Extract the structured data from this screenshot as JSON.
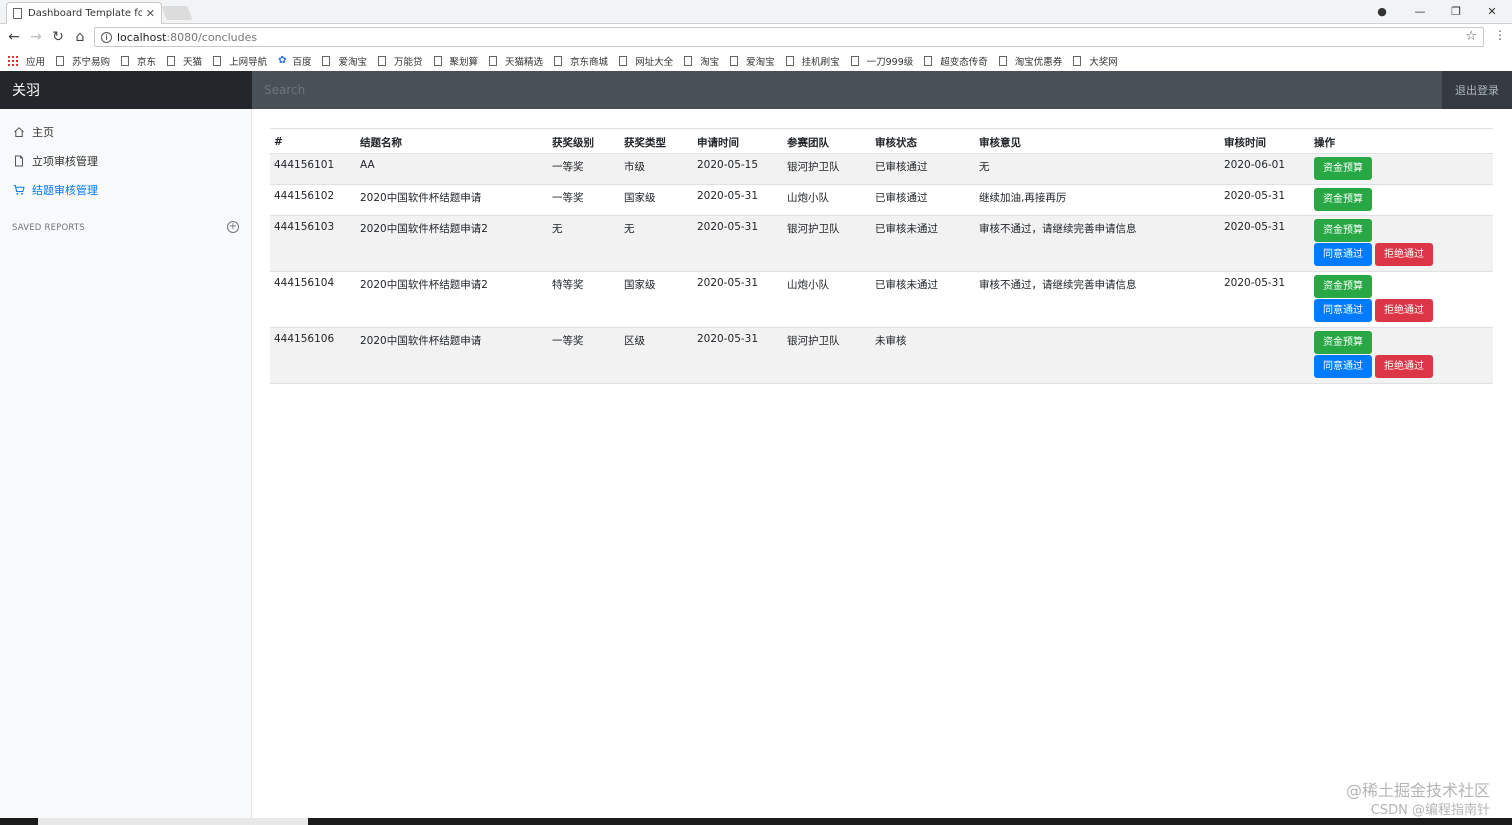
{
  "browser": {
    "tab_title": "Dashboard Template fc",
    "url_host": "localhost",
    "url_path": ":8080/concludes",
    "bookmarks": [
      "应用",
      "苏宁易购",
      "京东",
      "天猫",
      "上网导航",
      "百度",
      "爱淘宝",
      "万能贷",
      "聚划算",
      "天猫精选",
      "京东商城",
      "网址大全",
      "淘宝",
      "爱淘宝",
      "挂机刷宝",
      "一刀999级",
      "超变态传奇",
      "淘宝优惠券",
      "大奖网"
    ]
  },
  "header": {
    "brand": "关羽",
    "search_placeholder": "Search",
    "signout": "退出登录"
  },
  "sidebar": {
    "items": [
      {
        "label": "主页",
        "icon": "home-icon"
      },
      {
        "label": "立项审核管理",
        "icon": "file-icon"
      },
      {
        "label": "结题审核管理",
        "icon": "cart-icon",
        "active": true
      }
    ],
    "saved_reports": "SAVED REPORTS"
  },
  "table": {
    "headers": [
      "#",
      "结题名称",
      "获奖级别",
      "获奖类型",
      "申请时间",
      "参赛团队",
      "审核状态",
      "审核意见",
      "审核时间",
      "操作"
    ],
    "rows": [
      {
        "id": "444156101",
        "name": "AA",
        "level": "一等奖",
        "type": "市级",
        "apply_time": "2020-05-15",
        "team": "银河护卫队",
        "status": "已审核通过",
        "opinion": "无",
        "review_time": "2020-06-01"
      },
      {
        "id": "444156102",
        "name": "2020中国软件杯结题申请",
        "level": "一等奖",
        "type": "国家级",
        "apply_time": "2020-05-31",
        "team": "山炮小队",
        "status": "已审核通过",
        "opinion": "继续加油,再接再厉",
        "review_time": "2020-05-31"
      },
      {
        "id": "444156103",
        "name": "2020中国软件杯结题申请2",
        "level": "无",
        "type": "无",
        "apply_time": "2020-05-31",
        "team": "银河护卫队",
        "status": "已审核未通过",
        "opinion": "审核不通过，请继续完善申请信息",
        "review_time": "2020-05-31"
      },
      {
        "id": "444156104",
        "name": "2020中国软件杯结题申请2",
        "level": "特等奖",
        "type": "国家级",
        "apply_time": "2020-05-31",
        "team": "山炮小队",
        "status": "已审核未通过",
        "opinion": "审核不通过，请继续完善申请信息",
        "review_time": "2020-05-31"
      },
      {
        "id": "444156106",
        "name": "2020中国软件杯结题申请",
        "level": "一等奖",
        "type": "区级",
        "apply_time": "2020-05-31",
        "team": "银河护卫队",
        "status": "未审核",
        "opinion": "",
        "review_time": ""
      }
    ],
    "btn_budget": "资金预算",
    "btn_approve": "同意通过",
    "btn_reject": "拒绝通过"
  },
  "watermark": {
    "line1": "@稀土掘金技术社区",
    "line2": "CSDN @编程指南针"
  }
}
